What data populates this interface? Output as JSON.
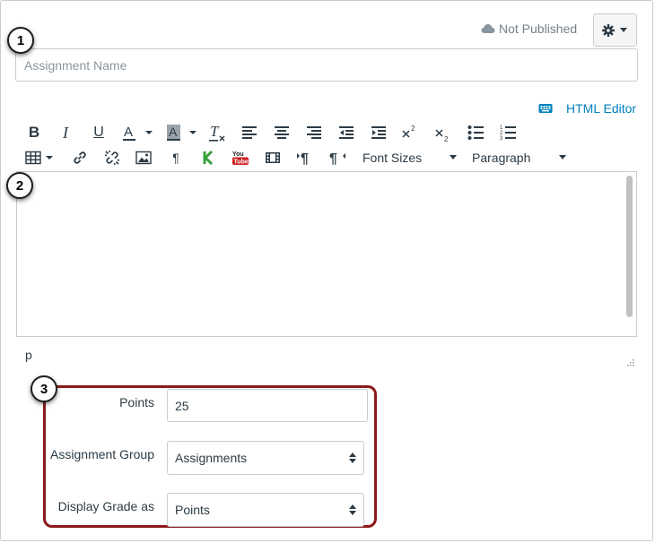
{
  "header": {
    "publish_status": "Not Published",
    "settings_icon": "gear-icon"
  },
  "assignment_name": {
    "placeholder": "Assignment Name",
    "value": ""
  },
  "editor": {
    "html_editor_label": "HTML Editor",
    "font_sizes_label": "Font Sizes",
    "paragraph_label": "Paragraph",
    "status_path": "p",
    "toolbar_row1_icons": [
      "bold-icon",
      "italic-icon",
      "underline-icon",
      "text-color-icon",
      "background-color-icon",
      "clear-formatting-icon",
      "align-left-icon",
      "align-center-icon",
      "align-right-icon",
      "outdent-icon",
      "indent-icon",
      "superscript-icon",
      "subscript-icon",
      "bullet-list-icon",
      "numbered-list-icon"
    ],
    "toolbar_row2_icons": [
      "table-icon",
      "link-icon",
      "unlink-icon",
      "image-icon",
      "paragraph-mark-icon",
      "kaltura-icon",
      "youtube-icon",
      "media-icon",
      "ltr-icon",
      "rtl-icon"
    ]
  },
  "callouts": [
    "1",
    "2",
    "3"
  ],
  "form": {
    "points_label": "Points",
    "points_value": "25",
    "group_label": "Assignment Group",
    "group_value": "Assignments",
    "display_label": "Display Grade as",
    "display_value": "Points"
  },
  "colors": {
    "link": "#0081bd",
    "highlight_border": "#8b1a1a",
    "kaltura": "#3aa23a",
    "youtube": "#cc1e1e"
  }
}
